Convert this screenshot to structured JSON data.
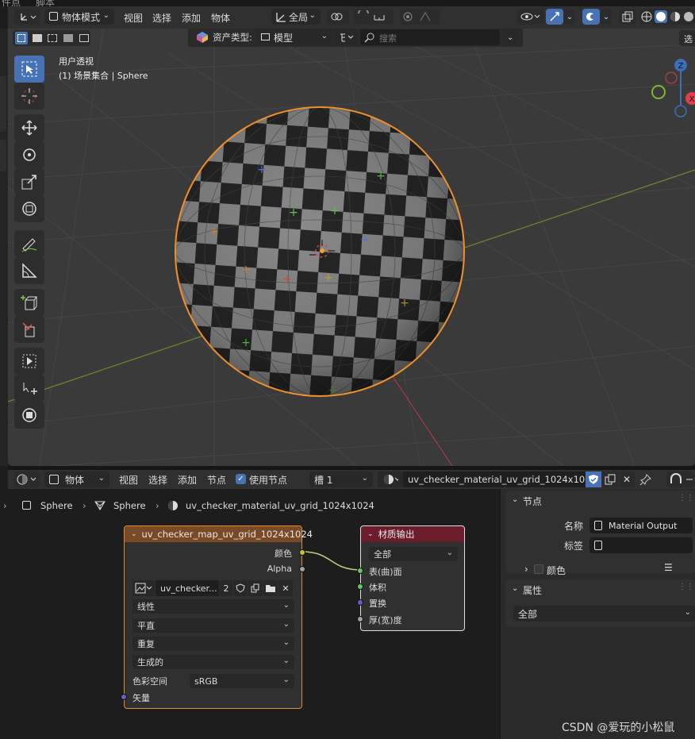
{
  "topstrip": {
    "menu1": "件点",
    "menu2": "脚本"
  },
  "header": {
    "mode": "物体模式",
    "menus": [
      "视图",
      "选择",
      "添加",
      "物体"
    ],
    "transform_orientation": "全局"
  },
  "asset_bar": {
    "label": "资产类型:",
    "type": "模型",
    "search_placeholder": "搜索"
  },
  "right_cut_label": "选",
  "viewport": {
    "view_name": "用户透视",
    "collection": "(1) 场景集合 | Sphere"
  },
  "gizmo": {
    "z": "Z",
    "x": "X"
  },
  "node_header": {
    "type_label": "物体",
    "menus": [
      "视图",
      "选择",
      "添加",
      "节点"
    ],
    "use_nodes": "使用节点",
    "slot": "槽 1",
    "material": "uv_checker_material_uv_grid_1024x1024"
  },
  "breadcrumb": {
    "object": "Sphere",
    "mesh": "Sphere",
    "material": "uv_checker_material_uv_grid_1024x1024"
  },
  "image_node": {
    "title": "uv_checker_map_uv_grid_1024x1024",
    "out_color": "颜色",
    "out_alpha": "Alpha",
    "image_name": "uv_checker...",
    "users": "2",
    "interpolation": "线性",
    "projection": "平直",
    "extension": "重复",
    "source": "生成的",
    "colorspace_label": "色彩空间",
    "colorspace": "sRGB",
    "in_vector": "矢量"
  },
  "output_node": {
    "title": "材质输出",
    "target": "全部",
    "in_surface": "表(曲)面",
    "in_volume": "体积",
    "in_displacement": "置换",
    "in_thickness": "厚(宽)度"
  },
  "sidebar": {
    "node_section": "节点",
    "name_label": "名称",
    "name_value": "Material Output",
    "tag_label": "标签",
    "color_section": "颜色",
    "props_section": "属性",
    "props_target": "全部"
  },
  "watermark": "CSDN @爱玩的小松鼠",
  "colors": {
    "accent": "#4772b3",
    "selection": "#f0902a",
    "node_image_header": "#7a4a26",
    "node_output_header": "#6b1d2b"
  }
}
